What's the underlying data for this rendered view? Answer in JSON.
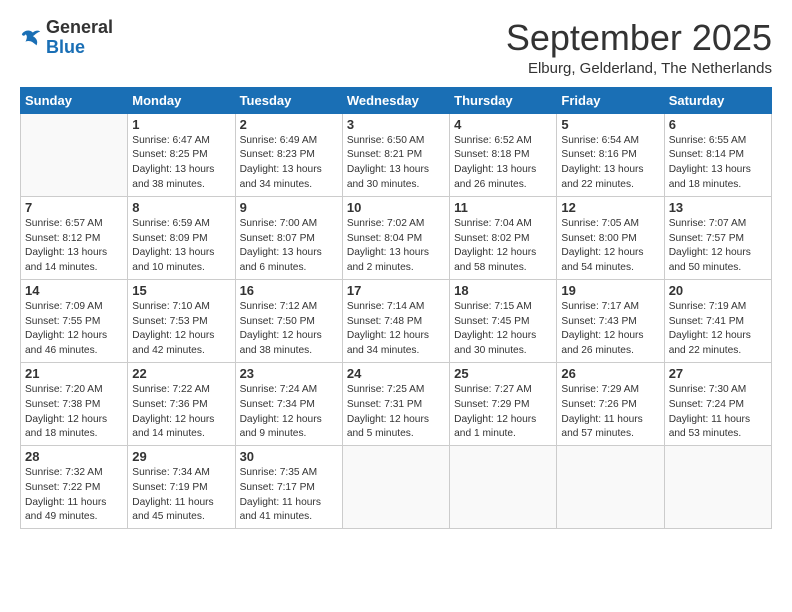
{
  "header": {
    "logo_general": "General",
    "logo_blue": "Blue",
    "month_title": "September 2025",
    "subtitle": "Elburg, Gelderland, The Netherlands"
  },
  "weekdays": [
    "Sunday",
    "Monday",
    "Tuesday",
    "Wednesday",
    "Thursday",
    "Friday",
    "Saturday"
  ],
  "weeks": [
    [
      {
        "day": "",
        "info": ""
      },
      {
        "day": "1",
        "info": "Sunrise: 6:47 AM\nSunset: 8:25 PM\nDaylight: 13 hours\nand 38 minutes."
      },
      {
        "day": "2",
        "info": "Sunrise: 6:49 AM\nSunset: 8:23 PM\nDaylight: 13 hours\nand 34 minutes."
      },
      {
        "day": "3",
        "info": "Sunrise: 6:50 AM\nSunset: 8:21 PM\nDaylight: 13 hours\nand 30 minutes."
      },
      {
        "day": "4",
        "info": "Sunrise: 6:52 AM\nSunset: 8:18 PM\nDaylight: 13 hours\nand 26 minutes."
      },
      {
        "day": "5",
        "info": "Sunrise: 6:54 AM\nSunset: 8:16 PM\nDaylight: 13 hours\nand 22 minutes."
      },
      {
        "day": "6",
        "info": "Sunrise: 6:55 AM\nSunset: 8:14 PM\nDaylight: 13 hours\nand 18 minutes."
      }
    ],
    [
      {
        "day": "7",
        "info": "Sunrise: 6:57 AM\nSunset: 8:12 PM\nDaylight: 13 hours\nand 14 minutes."
      },
      {
        "day": "8",
        "info": "Sunrise: 6:59 AM\nSunset: 8:09 PM\nDaylight: 13 hours\nand 10 minutes."
      },
      {
        "day": "9",
        "info": "Sunrise: 7:00 AM\nSunset: 8:07 PM\nDaylight: 13 hours\nand 6 minutes."
      },
      {
        "day": "10",
        "info": "Sunrise: 7:02 AM\nSunset: 8:04 PM\nDaylight: 13 hours\nand 2 minutes."
      },
      {
        "day": "11",
        "info": "Sunrise: 7:04 AM\nSunset: 8:02 PM\nDaylight: 12 hours\nand 58 minutes."
      },
      {
        "day": "12",
        "info": "Sunrise: 7:05 AM\nSunset: 8:00 PM\nDaylight: 12 hours\nand 54 minutes."
      },
      {
        "day": "13",
        "info": "Sunrise: 7:07 AM\nSunset: 7:57 PM\nDaylight: 12 hours\nand 50 minutes."
      }
    ],
    [
      {
        "day": "14",
        "info": "Sunrise: 7:09 AM\nSunset: 7:55 PM\nDaylight: 12 hours\nand 46 minutes."
      },
      {
        "day": "15",
        "info": "Sunrise: 7:10 AM\nSunset: 7:53 PM\nDaylight: 12 hours\nand 42 minutes."
      },
      {
        "day": "16",
        "info": "Sunrise: 7:12 AM\nSunset: 7:50 PM\nDaylight: 12 hours\nand 38 minutes."
      },
      {
        "day": "17",
        "info": "Sunrise: 7:14 AM\nSunset: 7:48 PM\nDaylight: 12 hours\nand 34 minutes."
      },
      {
        "day": "18",
        "info": "Sunrise: 7:15 AM\nSunset: 7:45 PM\nDaylight: 12 hours\nand 30 minutes."
      },
      {
        "day": "19",
        "info": "Sunrise: 7:17 AM\nSunset: 7:43 PM\nDaylight: 12 hours\nand 26 minutes."
      },
      {
        "day": "20",
        "info": "Sunrise: 7:19 AM\nSunset: 7:41 PM\nDaylight: 12 hours\nand 22 minutes."
      }
    ],
    [
      {
        "day": "21",
        "info": "Sunrise: 7:20 AM\nSunset: 7:38 PM\nDaylight: 12 hours\nand 18 minutes."
      },
      {
        "day": "22",
        "info": "Sunrise: 7:22 AM\nSunset: 7:36 PM\nDaylight: 12 hours\nand 14 minutes."
      },
      {
        "day": "23",
        "info": "Sunrise: 7:24 AM\nSunset: 7:34 PM\nDaylight: 12 hours\nand 9 minutes."
      },
      {
        "day": "24",
        "info": "Sunrise: 7:25 AM\nSunset: 7:31 PM\nDaylight: 12 hours\nand 5 minutes."
      },
      {
        "day": "25",
        "info": "Sunrise: 7:27 AM\nSunset: 7:29 PM\nDaylight: 12 hours\nand 1 minute."
      },
      {
        "day": "26",
        "info": "Sunrise: 7:29 AM\nSunset: 7:26 PM\nDaylight: 11 hours\nand 57 minutes."
      },
      {
        "day": "27",
        "info": "Sunrise: 7:30 AM\nSunset: 7:24 PM\nDaylight: 11 hours\nand 53 minutes."
      }
    ],
    [
      {
        "day": "28",
        "info": "Sunrise: 7:32 AM\nSunset: 7:22 PM\nDaylight: 11 hours\nand 49 minutes."
      },
      {
        "day": "29",
        "info": "Sunrise: 7:34 AM\nSunset: 7:19 PM\nDaylight: 11 hours\nand 45 minutes."
      },
      {
        "day": "30",
        "info": "Sunrise: 7:35 AM\nSunset: 7:17 PM\nDaylight: 11 hours\nand 41 minutes."
      },
      {
        "day": "",
        "info": ""
      },
      {
        "day": "",
        "info": ""
      },
      {
        "day": "",
        "info": ""
      },
      {
        "day": "",
        "info": ""
      }
    ]
  ]
}
